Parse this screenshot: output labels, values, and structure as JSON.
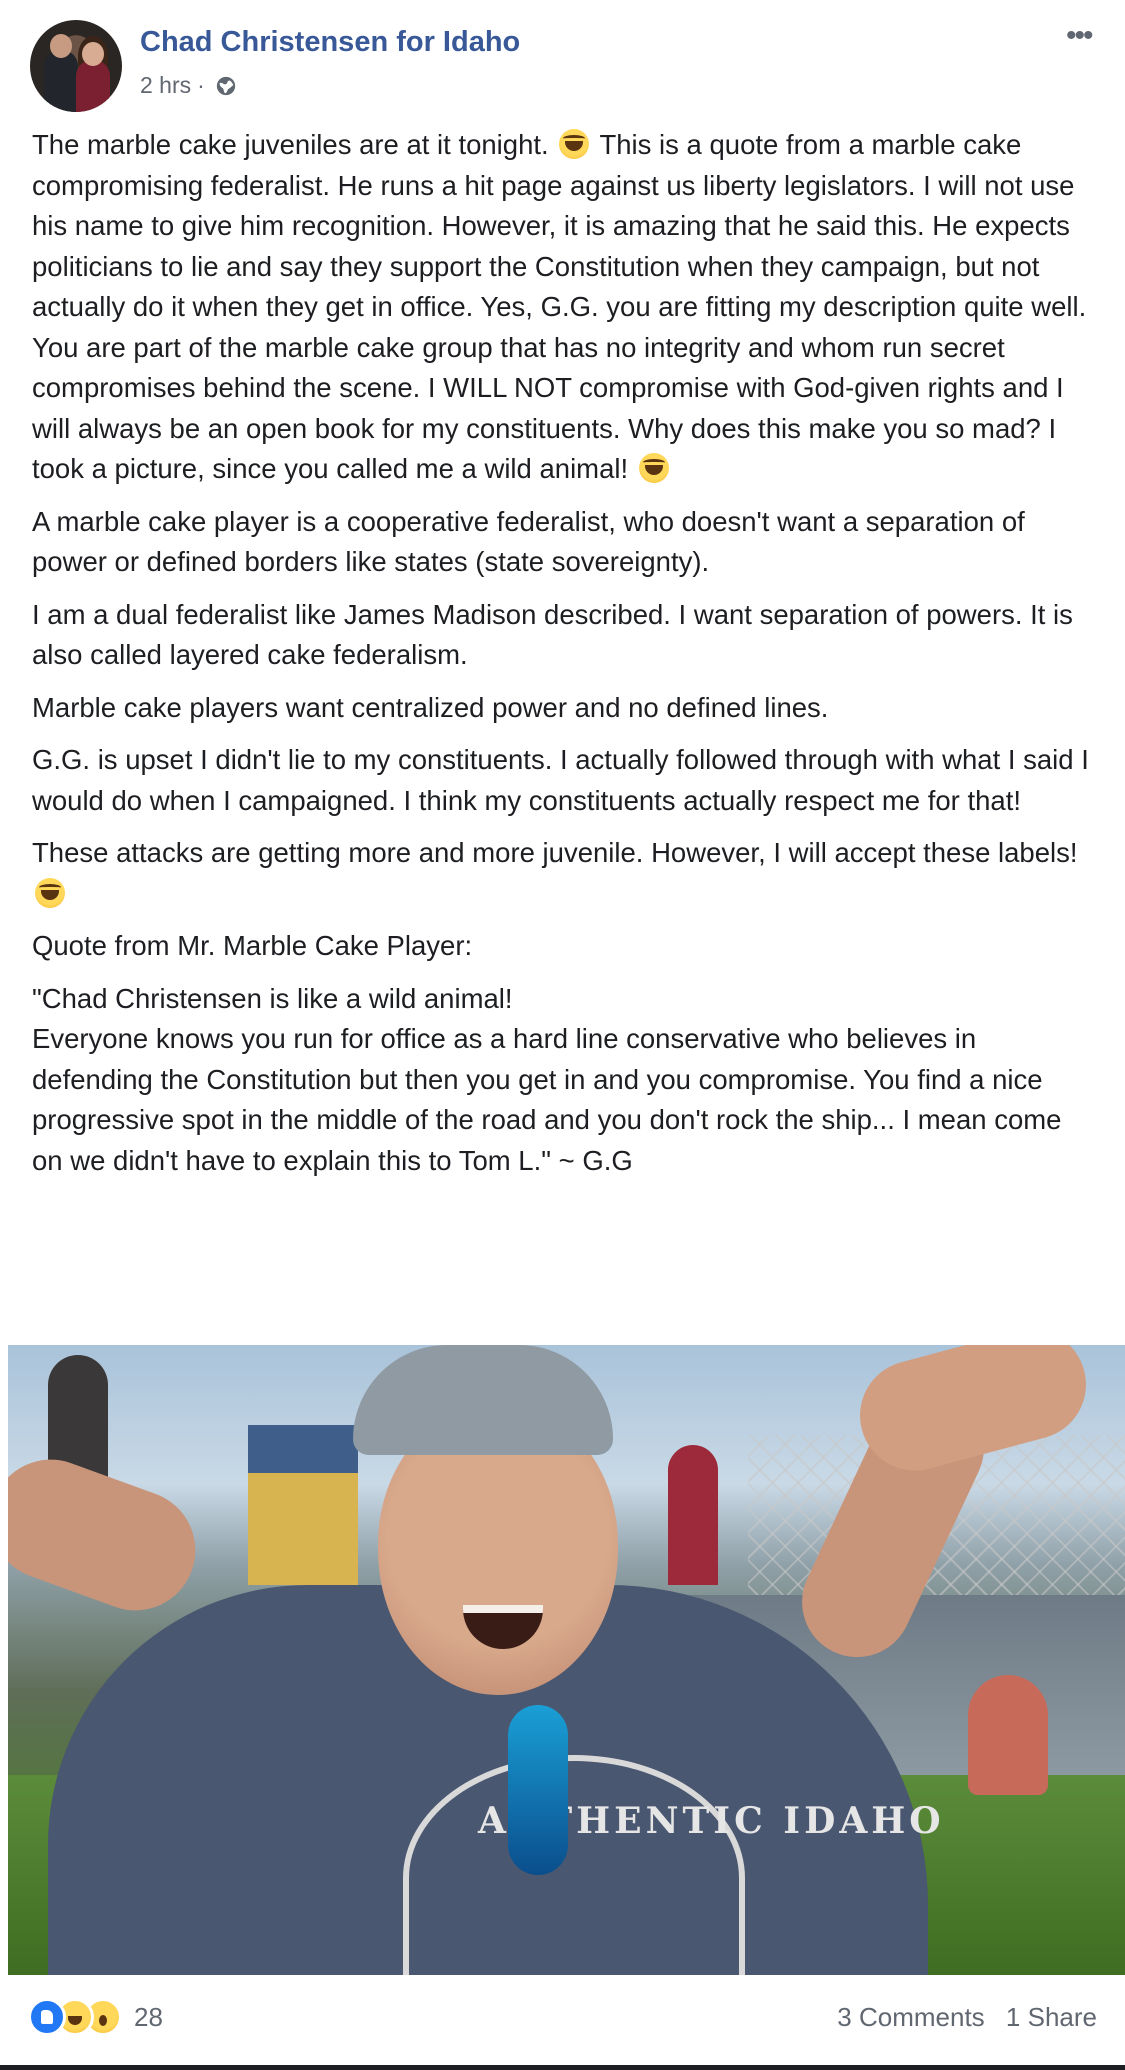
{
  "header": {
    "page_name": "Chad Christensen for Idaho",
    "time": "2 hrs",
    "separator": "·",
    "privacy_icon": "globe-icon",
    "more_icon": "more-options-icon",
    "more_glyph": "•••"
  },
  "post": {
    "paragraphs": [
      {
        "before_emoji": "The marble cake juveniles are at it tonight. ",
        "after_emoji": " This is a quote from a marble cake compromising federalist. He runs a hit page against us liberty legislators. I will not use his name to give him recognition. However, it is amazing that he said this. He expects politicians to lie and say they support the Constitution when they campaign, but not actually do it when they get in office. Yes, G.G. you are fitting my description quite well. You are part of the marble cake group that has no integrity and whom run secret compromises behind the scene. I WILL NOT compromise with God-given rights and I will always be an open book for my constituents. Why does this make you so mad? I took a picture, since you called me a wild animal! "
      },
      "A marble cake player is a cooperative federalist, who doesn't want a separation of power or defined borders like states (state sovereignty).",
      "I am a dual federalist like James Madison described. I want separation of powers. It is also called layered cake federalism.",
      "Marble cake players want centralized power and no defined lines.",
      "G.G. is upset I didn't lie to my constituents. I actually followed through with what I said I would do when I campaigned. I think my constituents actually respect me for that!",
      {
        "before_emoji": "These attacks are getting more and more juvenile. However, I will accept these labels! "
      },
      "Quote from Mr. Marble Cake Player:"
    ],
    "quote": {
      "line1": "\"Chad Christensen is like a wild animal!",
      "line2": "Everyone knows you run for office as a hard line conservative who believes in defending the Constitution but then you get in and you compromise. You find a nice progressive spot in the middle of the road and you don't rock the ship... I mean come on we didn't have to explain this to Tom L.\" ~ G.G"
    },
    "emoji_name": "laughing-crying-emoji"
  },
  "photo": {
    "shirt_text": "AUTHENTIC IDAHO"
  },
  "footer": {
    "reaction_icons": [
      "like-icon",
      "haha-icon",
      "wow-icon"
    ],
    "reaction_count": "28",
    "comments": "3 Comments",
    "shares": "1 Share"
  },
  "colors": {
    "page_name": "#385898",
    "meta_text": "#616770",
    "like_blue": "#2078f4"
  }
}
